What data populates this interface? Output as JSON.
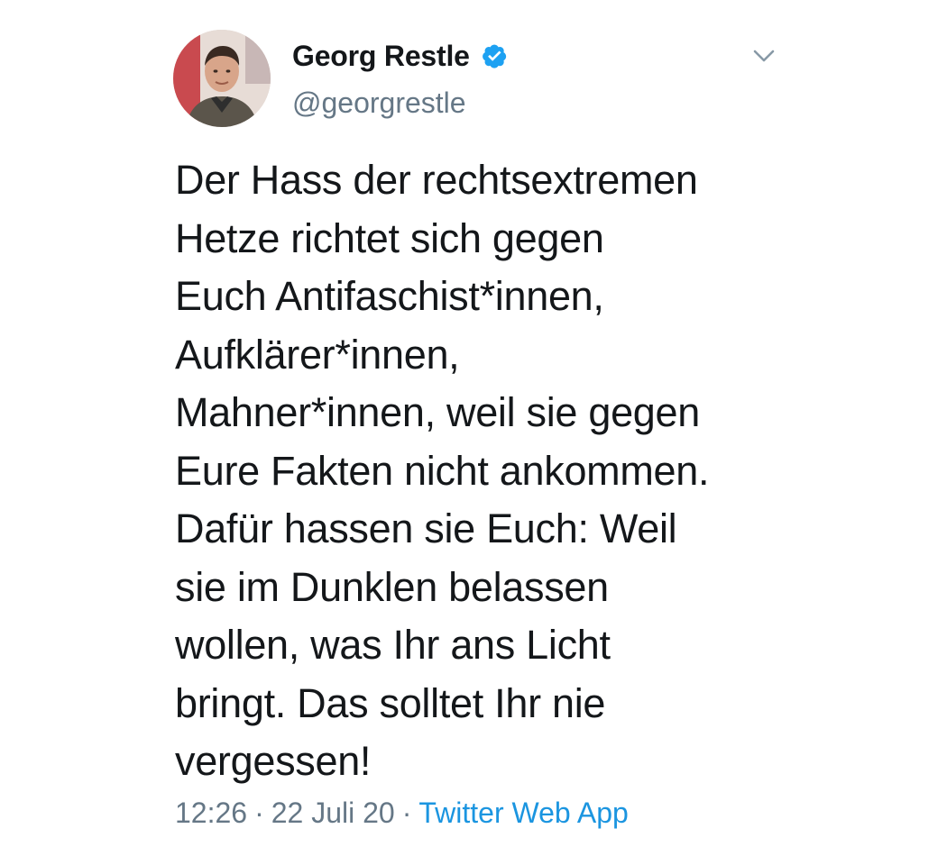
{
  "tweet": {
    "display_name": "Georg Restle",
    "handle": "@georgrestle",
    "verified": true,
    "verified_icon": "verified-badge-icon",
    "menu_icon": "chevron-down-icon",
    "text": "Der Hass der rechtsextremen\nHetze richtet sich gegen\nEuch Antifaschist*innen,\nAufklärer*innen,\nMahner*innen, weil sie gegen\nEure Fakten nicht ankommen.\nDafür hassen sie Euch: Weil\nsie im Dunklen belassen\nwollen, was Ihr ans Licht\nbringt. Das solltet Ihr nie\nvergessen!",
    "time": "12:26",
    "date": "22 Juli 20",
    "separator": "·",
    "source": "Twitter Web App"
  },
  "colors": {
    "text_primary": "#14171a",
    "text_secondary": "#657786",
    "link": "#1b95e0",
    "verified_badge": "#1da1f2"
  }
}
